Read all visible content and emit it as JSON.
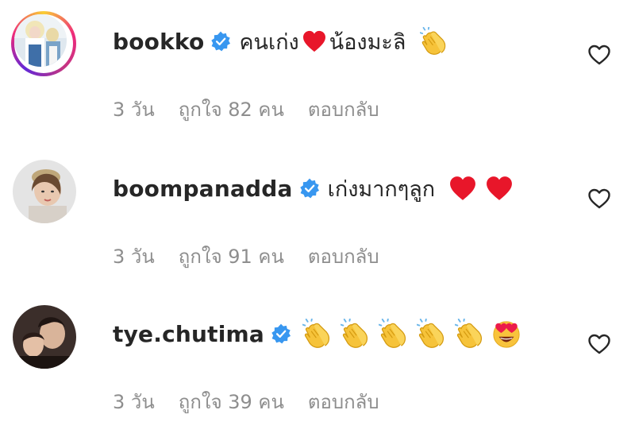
{
  "comments": [
    {
      "username": "bookko",
      "text_a": "คนเก่ง",
      "text_b": "น้องมะลิ",
      "time": "3 วัน",
      "likes": "ถูกใจ 82 คน",
      "reply": "ตอบกลับ"
    },
    {
      "username": "boompanadda",
      "text_a": "เก่งมากๆลูก",
      "time": "3 วัน",
      "likes": "ถูกใจ 91 คน",
      "reply": "ตอบกลับ"
    },
    {
      "username": "tye.chutima",
      "time": "3 วัน",
      "likes": "ถูกใจ 39 คน",
      "reply": "ตอบกลับ"
    }
  ],
  "colors": {
    "verified": "#3897f0",
    "heart": "#e8162a",
    "clap": "#f6c33a",
    "muted": "#8e8e8e"
  },
  "icons": [
    "verified-badge-icon",
    "red-heart-emoji",
    "clapping-hands-emoji",
    "heart-eyes-emoji",
    "heart-outline-icon"
  ]
}
